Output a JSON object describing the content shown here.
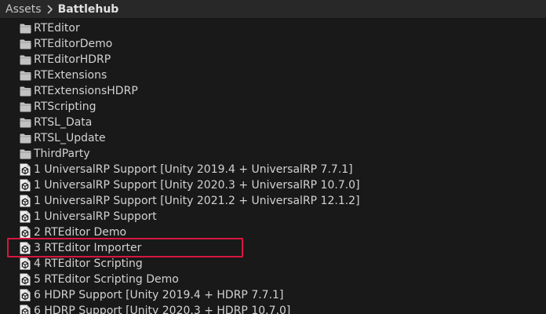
{
  "breadcrumb": {
    "items": [
      {
        "label": "Assets",
        "icon": "chevron-right-icon"
      },
      {
        "label": "Battlehub"
      }
    ]
  },
  "list": {
    "items": [
      {
        "label": "RTEditor",
        "icon": "folder-icon",
        "type": "folder"
      },
      {
        "label": "RTEditorDemo",
        "icon": "folder-icon",
        "type": "folder"
      },
      {
        "label": "RTEditorHDRP",
        "icon": "folder-icon",
        "type": "folder"
      },
      {
        "label": "RTExtensions",
        "icon": "folder-icon",
        "type": "folder"
      },
      {
        "label": "RTExtensionsHDRP",
        "icon": "folder-icon",
        "type": "folder"
      },
      {
        "label": "RTScripting",
        "icon": "folder-icon",
        "type": "folder"
      },
      {
        "label": "RTSL_Data",
        "icon": "folder-icon",
        "type": "folder"
      },
      {
        "label": "RTSL_Update",
        "icon": "folder-icon",
        "type": "folder"
      },
      {
        "label": "ThirdParty",
        "icon": "folder-icon",
        "type": "folder"
      },
      {
        "label": "1 UniversalRP Support [Unity 2019.4 + UniversalRP 7.7.1]",
        "icon": "unity-package-icon",
        "type": "package"
      },
      {
        "label": "1 UniversalRP Support [Unity 2020.3 + UniversalRP 10.7.0]",
        "icon": "unity-package-icon",
        "type": "package"
      },
      {
        "label": "1 UniversalRP Support [Unity 2021.2 + UniversalRP 12.1.2]",
        "icon": "unity-package-icon",
        "type": "package"
      },
      {
        "label": "1 UniversalRP Support",
        "icon": "unity-package-icon",
        "type": "package"
      },
      {
        "label": "2 RTEditor Demo",
        "icon": "unity-package-icon",
        "type": "package"
      },
      {
        "label": "3 RTEditor Importer",
        "icon": "unity-package-icon",
        "type": "package",
        "highlighted": true
      },
      {
        "label": "4 RTEditor Scripting",
        "icon": "unity-package-icon",
        "type": "package"
      },
      {
        "label": "5 RTEditor Scripting Demo",
        "icon": "unity-package-icon",
        "type": "package"
      },
      {
        "label": "6 HDRP Support [Unity 2019.4 + HDRP 7.7.1]",
        "icon": "unity-package-icon",
        "type": "package"
      },
      {
        "label": "6 HDRP Support [Unity 2020.3 + HDRP 10.7.0]",
        "icon": "unity-package-icon",
        "type": "package"
      }
    ]
  },
  "colors": {
    "background": "#191919",
    "breadcrumb_bar": "#282828",
    "text": "#d2d2d2",
    "highlight_border": "#d6163f"
  }
}
